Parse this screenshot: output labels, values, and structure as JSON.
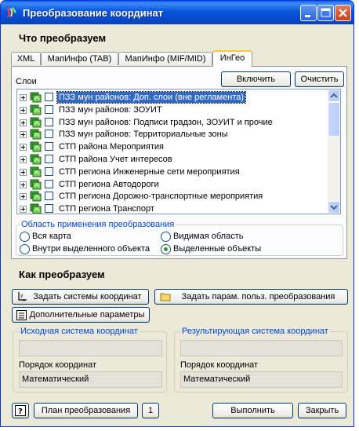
{
  "window": {
    "title": "Преобразование координат"
  },
  "what": {
    "heading": "Что преобразуем",
    "tabs": [
      {
        "label": "XML"
      },
      {
        "label": "МапИнфо (TAB)"
      },
      {
        "label": "МапИнфо (MIF/MID)"
      },
      {
        "label": "ИнГео"
      }
    ],
    "active_tab": "ИнГео",
    "layers_label": "Слои",
    "include_button": "Включить",
    "clear_button": "Очистить",
    "layers": [
      {
        "label": "ПЗЗ мун районов: Доп. слои (вне регламента)"
      },
      {
        "label": "ПЗЗ мун районов: ЗОУИТ"
      },
      {
        "label": "ПЗЗ мун районов: Подписи градзон, ЗОУИТ и прочие"
      },
      {
        "label": "ПЗЗ мун районов: Территориальные зоны"
      },
      {
        "label": "СТП района Мероприятия"
      },
      {
        "label": "СТП района Учет интересов"
      },
      {
        "label": "СТП региона Инженерные сети мероприятия"
      },
      {
        "label": "СТП региона Автодороги"
      },
      {
        "label": "СТП региона Дорожно-транспортные мероприятия"
      },
      {
        "label": "СТП региона Транспорт"
      }
    ],
    "scope": {
      "title": "Область применения преобразования",
      "options": [
        {
          "label": "Вся карта",
          "selected": false
        },
        {
          "label": "Видимая область",
          "selected": false
        },
        {
          "label": "Внутри выделенного объекта",
          "selected": false
        },
        {
          "label": "Выделенные объекты",
          "selected": true
        }
      ]
    }
  },
  "how": {
    "heading": "Как преобразуем",
    "set_systems_button": "Задать системы координат",
    "set_params_button": "Задать парам. польз. преобразования",
    "extra_params_button": "Дополнительные параметры",
    "source": {
      "title": "Исходная система координат",
      "system_value": "",
      "order_label": "Порядок координат",
      "order_value": "Математический"
    },
    "result": {
      "title": "Результирующая система координат",
      "system_value": "",
      "order_label": "Порядок координат",
      "order_value": "Математический"
    }
  },
  "footer": {
    "help_glyph": "?",
    "plan_button": "План преобразования",
    "plan_count": "1",
    "run_button": "Выполнить",
    "close_button": "Закрыть"
  },
  "colors": {
    "titlebar": "#0855dd",
    "dialog_bg": "#ece9d8",
    "selection": "#316ac5",
    "group_title": "#0046d5"
  }
}
